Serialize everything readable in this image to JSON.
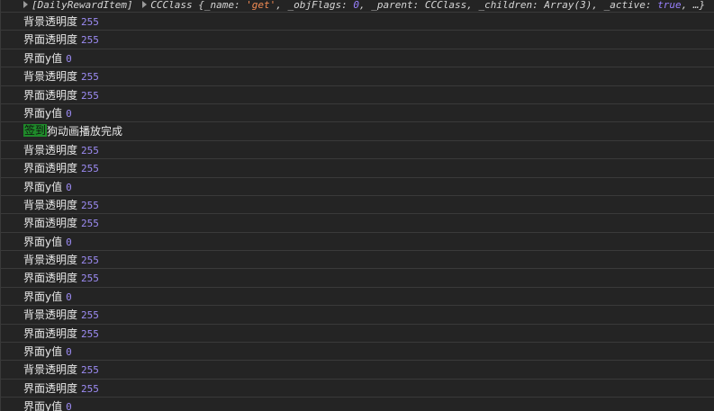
{
  "header": {
    "prefix": "[DailyRewardItem]",
    "class_name": "CCClass",
    "object_preview_parts": [
      {
        "t": "{",
        "c": "key"
      },
      {
        "t": "_name: ",
        "c": "key"
      },
      {
        "t": "'get'",
        "c": "str"
      },
      {
        "t": ", _objFlags: ",
        "c": "key"
      },
      {
        "t": "0",
        "c": "num"
      },
      {
        "t": ", _parent: ",
        "c": "key"
      },
      {
        "t": "CCClass",
        "c": "key"
      },
      {
        "t": ", _children: ",
        "c": "key"
      },
      {
        "t": "Array(3)",
        "c": "key"
      },
      {
        "t": ", _active: ",
        "c": "key"
      },
      {
        "t": "true",
        "c": "kw"
      },
      {
        "t": ", …}",
        "c": "key"
      }
    ]
  },
  "logs": [
    {
      "label": "背景透明度",
      "value": "255"
    },
    {
      "label": "界面透明度",
      "value": "255"
    },
    {
      "label": "界面y值",
      "value": "0"
    },
    {
      "label": "背景透明度",
      "value": "255"
    },
    {
      "label": "界面透明度",
      "value": "255"
    },
    {
      "label": "界面y值",
      "value": "0"
    },
    {
      "tag": "签到",
      "label": "狗动画播放完成",
      "value": ""
    },
    {
      "label": "背景透明度",
      "value": "255"
    },
    {
      "label": "界面透明度",
      "value": "255"
    },
    {
      "label": "界面y值",
      "value": "0"
    },
    {
      "label": "背景透明度",
      "value": "255"
    },
    {
      "label": "界面透明度",
      "value": "255"
    },
    {
      "label": "界面y值",
      "value": "0"
    },
    {
      "label": "背景透明度",
      "value": "255"
    },
    {
      "label": "界面透明度",
      "value": "255"
    },
    {
      "label": "界面y值",
      "value": "0"
    },
    {
      "label": "背景透明度",
      "value": "255"
    },
    {
      "label": "界面透明度",
      "value": "255"
    },
    {
      "label": "界面y值",
      "value": "0"
    },
    {
      "label": "背景透明度",
      "value": "255"
    },
    {
      "label": "界面透明度",
      "value": "255"
    },
    {
      "label": "界面y值",
      "value": "0"
    }
  ]
}
